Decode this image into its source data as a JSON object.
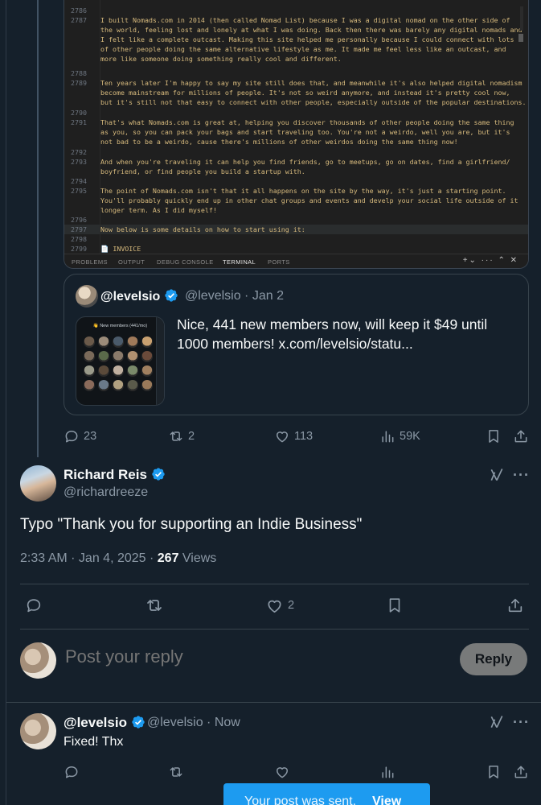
{
  "editor": {
    "lines": [
      {
        "n": "2786",
        "t": ""
      },
      {
        "n": "2787",
        "t": "I built Nomads.com in 2014 (then called Nomad List) because I was a digital nomad on the other side of"
      },
      {
        "n": "",
        "t": "the world, feeling lost and lonely at what I was doing. Back then there was barely any digital nomads and"
      },
      {
        "n": "",
        "t": "I felt like a complete outcast. Making this site helped me personally because I could connect with lots"
      },
      {
        "n": "",
        "t": "of other people doing the same alternative lifestyle as me. It made me feel less like an outcast, and"
      },
      {
        "n": "",
        "t": "more like someone doing something really cool and different."
      },
      {
        "n": "2788",
        "t": ""
      },
      {
        "n": "2789",
        "t": "Ten years later I'm happy to say my site still does that, and meanwhile it's also helped digital nomadism"
      },
      {
        "n": "",
        "t": "become mainstream for millions of people. It's not so weird anymore, and instead it's pretty cool now,"
      },
      {
        "n": "",
        "t": "but it's still not that easy to connect with other people, especially outside of the popular destinations."
      },
      {
        "n": "2790",
        "t": ""
      },
      {
        "n": "2791",
        "t": "That's what Nomads.com is great at, helping you discover thousands of other people doing the same thing"
      },
      {
        "n": "",
        "t": "as you, so you can pack your bags and start traveling too. You're not a weirdo, well you are, but it's"
      },
      {
        "n": "",
        "t": "not bad to be a weirdo, cause there's millions of other weirdos doing the same thing now!"
      },
      {
        "n": "2792",
        "t": ""
      },
      {
        "n": "2793",
        "t": "And when you're traveling it can help you find friends, go to meetups, go on dates, find a girlfriend/"
      },
      {
        "n": "",
        "t": "boyfriend, or find people you build a startup with."
      },
      {
        "n": "2794",
        "t": ""
      },
      {
        "n": "2795",
        "t": "The point of Nomads.com isn't that it all happens on the site by the way, it's just a starting point."
      },
      {
        "n": "",
        "t": "You'll probably quickly end up in other chat groups and events and develp your social life outside of it"
      },
      {
        "n": "",
        "t": "longer term. As I did myself!"
      },
      {
        "n": "2796",
        "t": ""
      },
      {
        "n": "2797",
        "t": "Now below is some details on how to start using it:"
      },
      {
        "n": "2798",
        "t": ""
      },
      {
        "n": "2799",
        "t": "📄 INVOICE"
      }
    ],
    "panel_tabs": [
      "PROBLEMS",
      "OUTPUT",
      "DEBUG CONSOLE",
      "TERMINAL",
      "PORTS"
    ],
    "active_tab": "TERMINAL"
  },
  "quote": {
    "name": "@levelsio",
    "handle_date": "@levelsio · Jan 2",
    "media_title": "👋 New members (441/mo)",
    "text": "Nice, 441 new members now, will keep it $49 until 1000 members!  x.com/levelsio/statu..."
  },
  "quote_actions": {
    "replies": "23",
    "reposts": "2",
    "likes": "113",
    "views": "59K"
  },
  "reply_tweet": {
    "name": "Richard Reis",
    "handle": "@richardreeze",
    "text": "Typo \"Thank you for supporting an Indie Business\"",
    "time": "2:33 AM · Jan 4, 2025 · ",
    "views_count": "267",
    "views_label": " Views",
    "likes": "2"
  },
  "composer": {
    "placeholder": "Post your reply",
    "button": "Reply"
  },
  "new_reply": {
    "name": "@levelsio",
    "handle_time": "@levelsio · Now",
    "text": "Fixed! Thx"
  },
  "toast": {
    "message": "Your post was sent.",
    "action": "View"
  },
  "colors": {
    "background": "#15202b",
    "accent": "#1d9bf0",
    "muted": "#8b98a5",
    "border": "#38444d"
  }
}
